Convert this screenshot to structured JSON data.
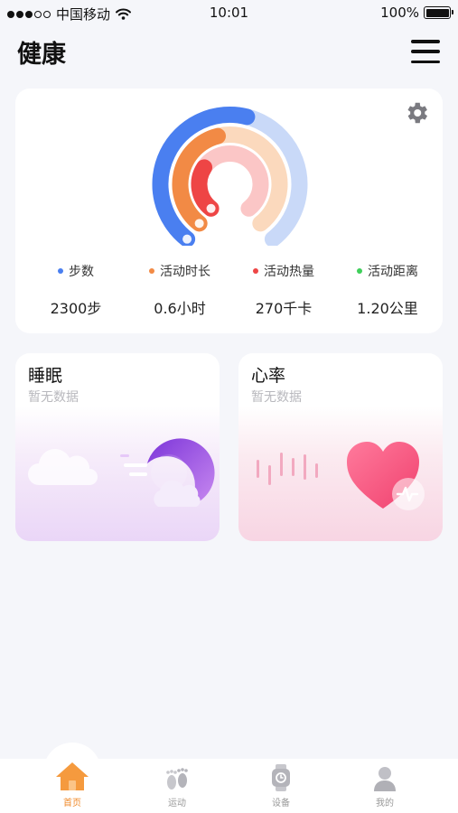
{
  "status_bar": {
    "carrier": "中国移动",
    "time": "10:01",
    "battery": "100%",
    "battery_level": 1.0
  },
  "header": {
    "title": "健康",
    "menu_icon": "hamburger-menu-icon"
  },
  "activity": {
    "settings_icon": "gear-icon",
    "rings": [
      {
        "name": "步数",
        "color": "#4a7ff0",
        "track": "#c9d9f8",
        "progress": 0.55
      },
      {
        "name": "活动时长",
        "color": "#f28a45",
        "track": "#fbd9bd",
        "progress": 0.45
      },
      {
        "name": "活动热量",
        "color": "#ee4545",
        "track": "#fbc6c6",
        "progress": 0.3
      }
    ],
    "metrics": [
      {
        "label": "步数",
        "value": "2300步",
        "color": "#4a7ff0"
      },
      {
        "label": "活动时长",
        "value": "0.6小时",
        "color": "#f28a45"
      },
      {
        "label": "活动热量",
        "value": "270千卡",
        "color": "#ee4545"
      },
      {
        "label": "活动距离",
        "value": "1.20公里",
        "color": "#3fcf5a"
      }
    ]
  },
  "cards": {
    "sleep": {
      "title": "睡眠",
      "subtitle": "暂无数据",
      "icon": "moon-cloud-icon"
    },
    "heart": {
      "title": "心率",
      "subtitle": "暂无数据",
      "icon": "heart-pulse-icon"
    }
  },
  "tabs": [
    {
      "label": "首页",
      "icon": "home-icon",
      "active": true
    },
    {
      "label": "运动",
      "icon": "footprints-icon",
      "active": false
    },
    {
      "label": "设备",
      "icon": "watch-icon",
      "active": false
    },
    {
      "label": "我的",
      "icon": "person-icon",
      "active": false
    }
  ]
}
